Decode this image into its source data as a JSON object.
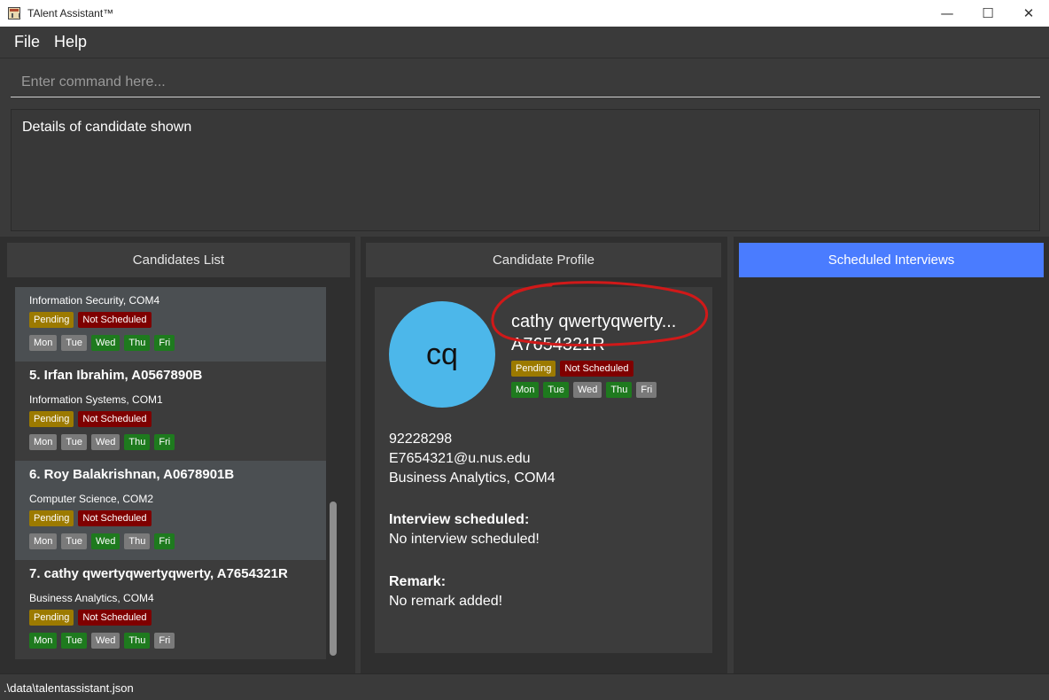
{
  "window": {
    "title": "TAlent Assistant™",
    "controls": {
      "minimize": "—",
      "maximize": "☐",
      "close": "✕"
    }
  },
  "menu": {
    "file": "File",
    "help": "Help"
  },
  "command": {
    "placeholder": "Enter command here..."
  },
  "result": {
    "text": "Details of candidate shown"
  },
  "panels": {
    "candidates_list": "Candidates List",
    "candidate_profile": "Candidate Profile",
    "scheduled_interviews": "Scheduled Interviews"
  },
  "colors": {
    "pending": "#9c7a00",
    "not_scheduled": "#7f0000",
    "day_available": "#1e7a1e",
    "day_unavailable": "#7a7a7a",
    "accent": "#4a7cff"
  },
  "candidates": [
    {
      "name": "",
      "program": "Information Security, COM4",
      "status": "Pending",
      "schedule": "Not Scheduled",
      "days": [
        {
          "label": "Mon",
          "available": false
        },
        {
          "label": "Tue",
          "available": false
        },
        {
          "label": "Wed",
          "available": true
        },
        {
          "label": "Thu",
          "available": true
        },
        {
          "label": "Fri",
          "available": true
        }
      ]
    },
    {
      "name": "5.  Irfan Ibrahim, A0567890B",
      "program": "Information Systems, COM1",
      "status": "Pending",
      "schedule": "Not Scheduled",
      "days": [
        {
          "label": "Mon",
          "available": false
        },
        {
          "label": "Tue",
          "available": false
        },
        {
          "label": "Wed",
          "available": false
        },
        {
          "label": "Thu",
          "available": true
        },
        {
          "label": "Fri",
          "available": true
        }
      ]
    },
    {
      "name": "6.  Roy Balakrishnan, A0678901B",
      "program": "Computer Science, COM2",
      "status": "Pending",
      "schedule": "Not Scheduled",
      "days": [
        {
          "label": "Mon",
          "available": false
        },
        {
          "label": "Tue",
          "available": false
        },
        {
          "label": "Wed",
          "available": true
        },
        {
          "label": "Thu",
          "available": false
        },
        {
          "label": "Fri",
          "available": true
        }
      ]
    },
    {
      "name": "7.  cathy qwertyqwertyqwerty, A7654321R",
      "program": "Business Analytics, COM4",
      "status": "Pending",
      "schedule": "Not Scheduled",
      "days": [
        {
          "label": "Mon",
          "available": true
        },
        {
          "label": "Tue",
          "available": true
        },
        {
          "label": "Wed",
          "available": false
        },
        {
          "label": "Thu",
          "available": true
        },
        {
          "label": "Fri",
          "available": false
        }
      ]
    }
  ],
  "profile": {
    "initials": "cq",
    "name": "cathy qwertyqwerty...",
    "id": "A7654321R",
    "status": "Pending",
    "schedule": "Not Scheduled",
    "days": [
      {
        "label": "Mon",
        "available": true
      },
      {
        "label": "Tue",
        "available": true
      },
      {
        "label": "Wed",
        "available": false
      },
      {
        "label": "Thu",
        "available": true
      },
      {
        "label": "Fri",
        "available": false
      }
    ],
    "phone": "92228298",
    "email": "E7654321@u.nus.edu",
    "program": "Business Analytics, COM4",
    "interview_heading": "Interview scheduled:",
    "interview_value": "No interview scheduled!",
    "remark_heading": "Remark:",
    "remark_value": "No remark added!"
  },
  "status_bar": {
    "path": ".\\data\\talentassistant.json"
  }
}
